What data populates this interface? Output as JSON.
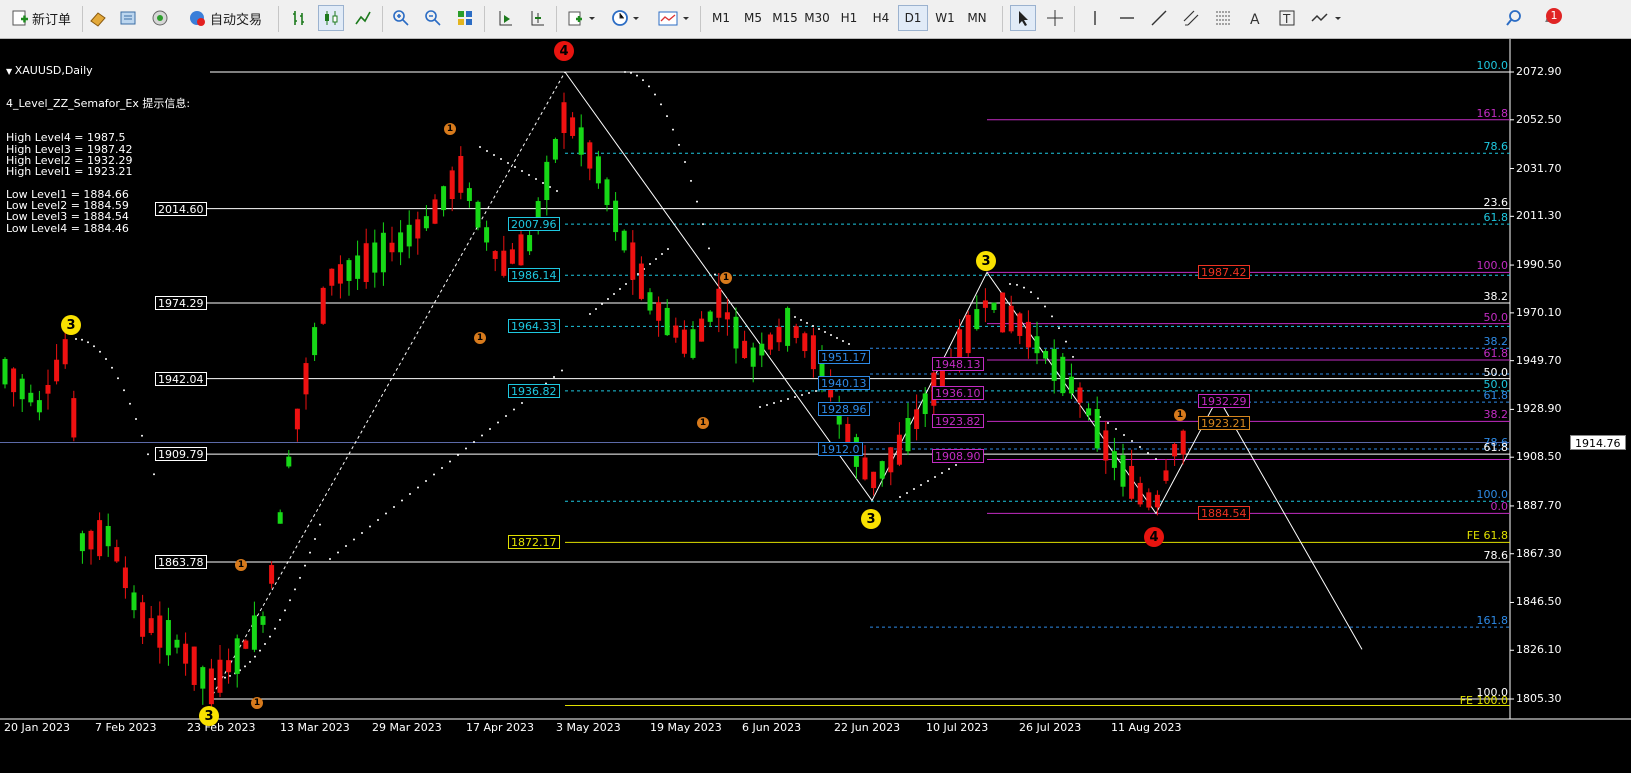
{
  "toolbar": {
    "new_order": "新订单",
    "auto_trading": "自动交易",
    "timeframes": [
      "M1",
      "M5",
      "M15",
      "M30",
      "H1",
      "H4",
      "D1",
      "W1",
      "MN"
    ],
    "active_timeframe": "D1",
    "icons": [
      "new-order-icon",
      "market-watch-icon",
      "data-window-icon",
      "navigator-icon",
      "auto-trading-icon",
      "bar-chart-icon",
      "candlestick-icon",
      "line-chart-icon",
      "zoom-in-icon",
      "zoom-out-icon",
      "tile-windows-icon",
      "autoscroll-icon",
      "chart-shift-icon",
      "indicators-icon",
      "periods-icon",
      "templates-icon",
      "cursor-icon",
      "crosshair-icon",
      "vertical-line-icon",
      "horizontal-line-icon",
      "trendline-icon",
      "equidistant-channel-icon",
      "fibonacci-icon",
      "text-icon",
      "text-label-icon",
      "arrows-icon",
      "search-icon",
      "alerts-icon"
    ],
    "alert_count": "1"
  },
  "chart": {
    "symbol_label": "XAUUSD,Daily",
    "indicator_info": "4_Level_ZZ_Semafor_Ex 提示信息:",
    "levels": [
      "High Level4 = 1987.5",
      "High Level3 = 1987.42",
      "High Level2 = 1932.29",
      "High Level1 = 1923.21",
      "",
      "Low Level1 = 1884.66",
      "Low Level2 = 1884.59",
      "Low Level3 = 1884.54",
      "Low Level4 = 1884.46"
    ],
    "current_price": "1914.76",
    "price_axis": [
      "2072.90",
      "2052.50",
      "2031.70",
      "2011.30",
      "1990.50",
      "1970.10",
      "1949.70",
      "1928.90",
      "1908.50",
      "1887.70",
      "1867.30",
      "1846.50",
      "1826.10",
      "1805.30"
    ],
    "date_axis": [
      "20 Jan 2023",
      "7 Feb 2023",
      "23 Feb 2023",
      "13 Mar 2023",
      "29 Mar 2023",
      "17 Apr 2023",
      "3 May 2023",
      "19 May 2023",
      "6 Jun 2023",
      "22 Jun 2023",
      "10 Jul 2023",
      "26 Jul 2023",
      "11 Aug 2023"
    ],
    "white_price_labels": [
      "2014.60",
      "1974.29",
      "1942.04",
      "1909.79",
      "1863.78"
    ],
    "cyan_price_labels": [
      "2007.96",
      "1986.14",
      "1964.33",
      "1936.82"
    ],
    "yellow_price_label": "1872.17",
    "blue_price_labels": [
      "1951.17",
      "1940.13",
      "1928.96",
      "1912.0"
    ],
    "magenta_price_labels": [
      "1948.13",
      "1936.10",
      "1923.82",
      "1908.90"
    ],
    "red_price_labels": [
      "1987.42",
      "1884.54"
    ],
    "recent_labels": [
      "1932.29",
      "1923.21"
    ],
    "fib_labels": {
      "right_white": [
        "23.6",
        "38.2",
        "50.0",
        "61.8",
        "78.6",
        "100.0"
      ],
      "right_cyan": [
        "100.0",
        "78.6",
        "61.8",
        "50.0"
      ],
      "right_magenta": [
        "161.8",
        "100.0",
        "61.8",
        "50.0",
        "38.2",
        "0.0"
      ],
      "right_blue": [
        "38.2",
        "61.8",
        "78.6",
        "100.0",
        "161.8"
      ],
      "fe": [
        "FE 61.8",
        "FE 100.0"
      ],
      "mixed": [
        "100.0",
        "38.2",
        "61.8",
        "78.6"
      ]
    },
    "semafor": {
      "big": [
        "4",
        "3",
        "3",
        "3",
        "4",
        "3"
      ],
      "small": [
        "1",
        "1",
        "1",
        "1",
        "1",
        "1",
        "1"
      ]
    },
    "colors": {
      "bull": "#17d817",
      "bear": "#ee1111",
      "fib_cyan": "#1ec8e0",
      "fib_magenta": "#c32cc3",
      "fib_yellow": "#e0e000",
      "fib_blue": "#2e8ae6"
    }
  }
}
